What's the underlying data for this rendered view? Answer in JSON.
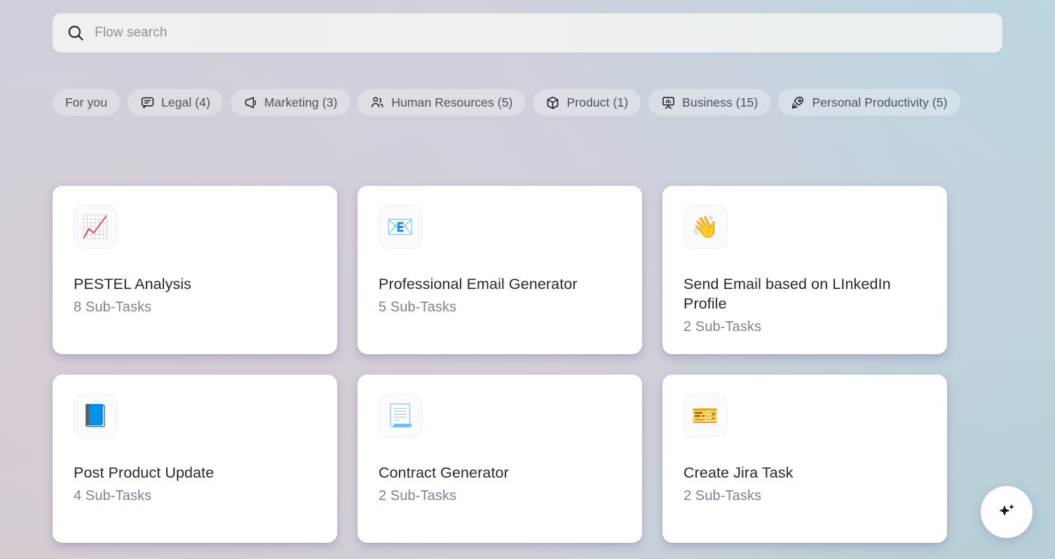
{
  "search": {
    "placeholder": "Flow search",
    "value": "",
    "icon": "search-icon"
  },
  "filters": [
    {
      "label": "For you",
      "icon": "none"
    },
    {
      "label": "Legal (4)",
      "icon": "chat-bubble-icon"
    },
    {
      "label": "Marketing (3)",
      "icon": "megaphone-icon"
    },
    {
      "label": "Human Resources (5)",
      "icon": "users-icon"
    },
    {
      "label": "Product (1)",
      "icon": "cube-icon"
    },
    {
      "label": "Business (15)",
      "icon": "presentation-chart-icon"
    },
    {
      "label": "Personal Productivity (5)",
      "icon": "rocket-icon"
    }
  ],
  "cards": [
    {
      "emoji": "📈",
      "icon": "chart-increasing-icon",
      "title": "PESTEL Analysis",
      "subtasks": "8 Sub-Tasks"
    },
    {
      "emoji": "📧",
      "icon": "email-icon",
      "title": "Professional Email Generator",
      "subtasks": "5 Sub-Tasks"
    },
    {
      "emoji": "👋",
      "icon": "waving-hand-icon",
      "title": "Send Email based on LInkedIn Profile",
      "subtasks": "2 Sub-Tasks"
    },
    {
      "emoji": "📘",
      "icon": "blue-book-icon",
      "title": "Post Product Update",
      "subtasks": "4 Sub-Tasks"
    },
    {
      "emoji": "📃",
      "icon": "page-with-curl-icon",
      "title": "Contract Generator",
      "subtasks": "2 Sub-Tasks"
    },
    {
      "emoji": "🎫",
      "icon": "ticket-icon",
      "title": "Create Jira Task",
      "subtasks": "2 Sub-Tasks"
    }
  ],
  "assistant_button": {
    "icon": "sparkles-icon",
    "label": ""
  },
  "colors": {
    "card_background": "#ffffff",
    "card_shadow": "#7869a3",
    "text_primary": "#222834",
    "text_secondary": "#7d838c",
    "chip_text": "#4b5159",
    "search_placeholder": "#8b9099",
    "background_blue": "#bad6e2",
    "background_mauve": "#d6cdd6"
  }
}
